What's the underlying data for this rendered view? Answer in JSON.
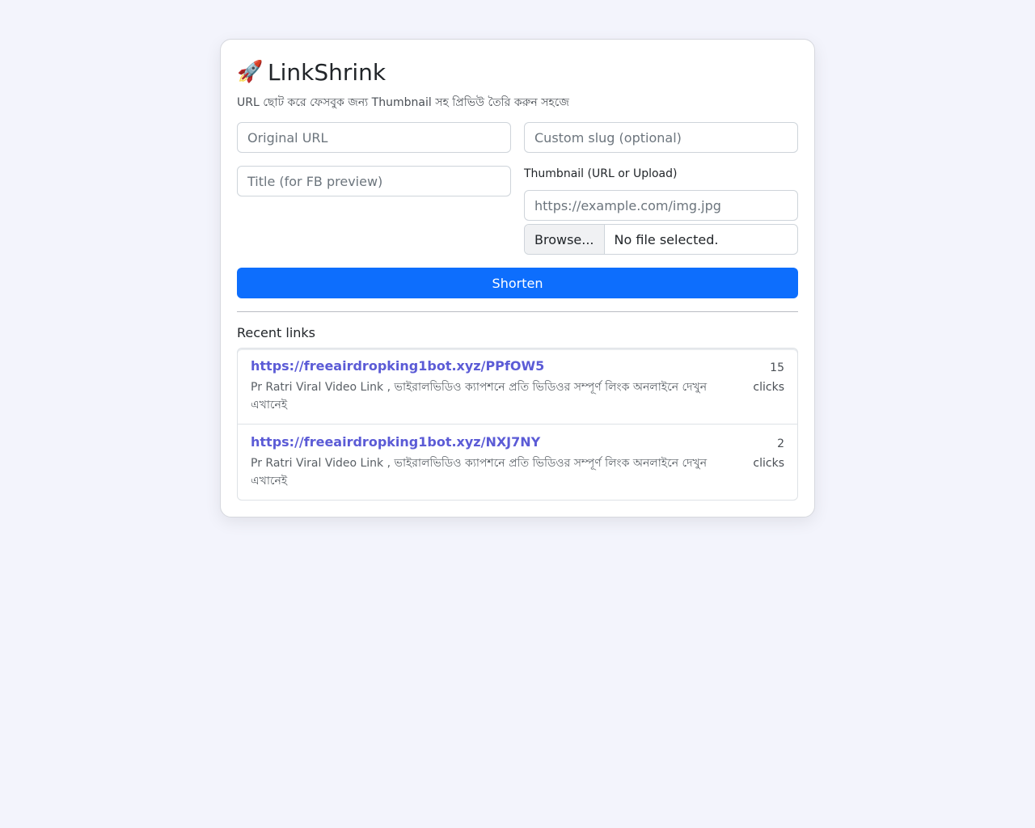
{
  "header": {
    "icon": "rocket-icon",
    "title": "LinkShrink",
    "subtitle": "URL ছোট করে ফেসবুক জন্য Thumbnail সহ প্রিভিউ তৈরি করুন সহজে"
  },
  "form": {
    "original_url_placeholder": "Original URL",
    "custom_slug_placeholder": "Custom slug (optional)",
    "title_placeholder": "Title (for FB preview)",
    "thumbnail_label": "Thumbnail (URL or Upload)",
    "thumbnail_url_placeholder": "https://example.com/img.jpg",
    "browse_label": "Browse...",
    "file_status": "No file selected.",
    "submit_label": "Shorten"
  },
  "recent": {
    "title": "Recent links",
    "items": [
      {
        "url": "https://freeairdropking1bot.xyz/PPfOW5",
        "description": "Pr Ratri Viral Video Link , ভাইরালভিডিও ক্যাপশনে প্রতি ভিডিওর সম্পূর্ণ লিংক অনলাইনে দেখুন এখানেই",
        "clicks_count": "15",
        "clicks_label": "clicks"
      },
      {
        "url": "https://freeairdropking1bot.xyz/NXJ7NY",
        "description": "Pr Ratri Viral Video Link , ভাইরালভিডিও ক্যাপশনে প্রতি ভিডিওর সম্পূর্ণ লিংক অনলাইনে দেখুন এখানেই",
        "clicks_count": "2",
        "clicks_label": "clicks"
      }
    ]
  }
}
